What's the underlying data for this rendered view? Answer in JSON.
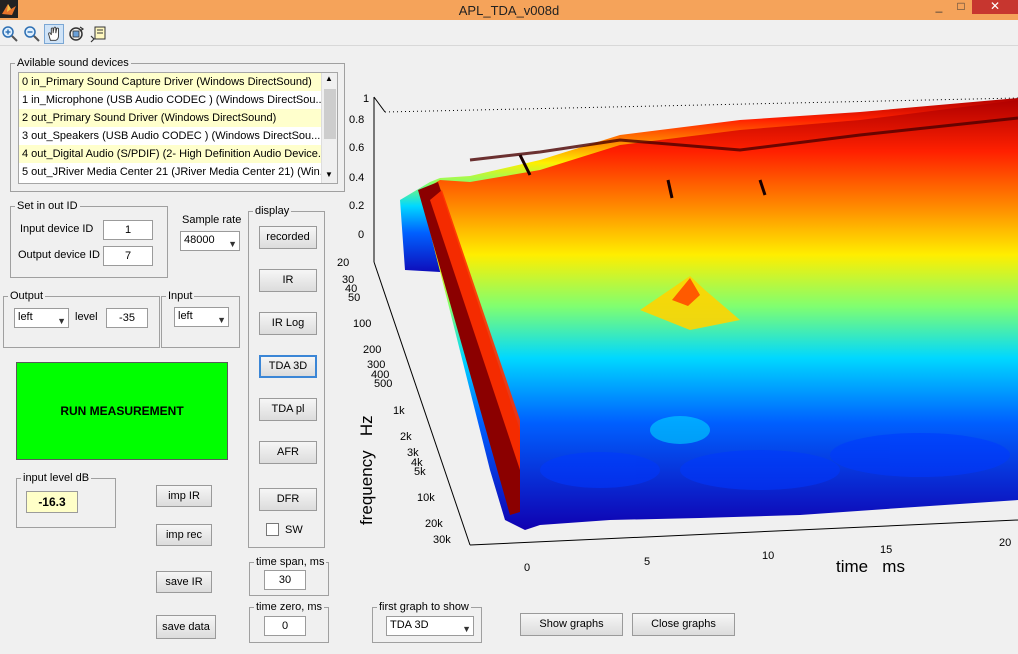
{
  "window": {
    "title": "APL_TDA_v008d"
  },
  "window_controls": {
    "minimize": "_",
    "maximize": "□",
    "close": "✕"
  },
  "toolbar": {
    "icons": [
      "zoom-in-icon",
      "zoom-out-icon",
      "pan-hand-icon",
      "rotate-3d-icon",
      "data-cursor-icon"
    ]
  },
  "devices": {
    "legend": "Avilable sound devices",
    "items": [
      "0 in_Primary Sound Capture Driver (Windows DirectSound)",
      "1 in_Microphone (USB Audio CODEC ) (Windows DirectSou...",
      "2 out_Primary Sound Driver (Windows DirectSound)",
      "3 out_Speakers (USB Audio CODEC ) (Windows DirectSou...",
      "4 out_Digital Audio (S/PDIF) (2- High Definition Audio Device...",
      "5 out_JRiver Media Center 21 (JRiver Media Center 21) (Win..."
    ]
  },
  "set_io": {
    "legend": "Set in out ID",
    "input_label": "Input device ID",
    "input_value": "1",
    "output_label": "Output device ID",
    "output_value": "7"
  },
  "sample_rate": {
    "label": "Sample rate",
    "value": "48000"
  },
  "output": {
    "legend": "Output",
    "channel": "left",
    "level_label": "level",
    "level_value": "-35"
  },
  "input": {
    "legend": "Input",
    "channel": "left"
  },
  "run_button": "RUN MEASUREMENT",
  "input_level": {
    "legend": "input level dB",
    "value": "-16.3"
  },
  "side_buttons": {
    "imp_ir": "imp IR",
    "imp_rec": "imp rec",
    "save_ir": "save IR",
    "save_data": "save data"
  },
  "display": {
    "legend": "display",
    "buttons": [
      "recorded",
      "IR",
      "IR Log",
      "TDA 3D",
      "TDA pl",
      "AFR",
      "DFR"
    ],
    "selected": "TDA 3D",
    "sw_label": "SW",
    "sw_checked": false
  },
  "time_span": {
    "legend": "time span, ms",
    "value": "30"
  },
  "time_zero": {
    "legend": "time zero, ms",
    "value": "0"
  },
  "first_graph": {
    "legend": "first graph to show",
    "value": "TDA 3D"
  },
  "bottom_buttons": {
    "show": "Show graphs",
    "close": "Close graphs"
  },
  "chart_data": {
    "type": "surface-3d",
    "title": "",
    "xlabel": "time   ms",
    "ylabel": "frequency   Hz",
    "zlabel": "",
    "x_ticks": [
      "0",
      "5",
      "10",
      "15",
      "20"
    ],
    "y_ticks": [
      "20",
      "30",
      "40",
      "50",
      "100",
      "200",
      "300",
      "400",
      "500",
      "1k",
      "2k",
      "3k",
      "4k",
      "5k",
      "10k",
      "20k",
      "30k"
    ],
    "z_ticks": [
      "0",
      "0.2",
      "0.4",
      "0.6",
      "0.8",
      "1"
    ],
    "xlim": [
      0,
      20
    ],
    "zlim": [
      0,
      1
    ],
    "y_scale": "log",
    "colormap": "jet",
    "grid": true
  }
}
